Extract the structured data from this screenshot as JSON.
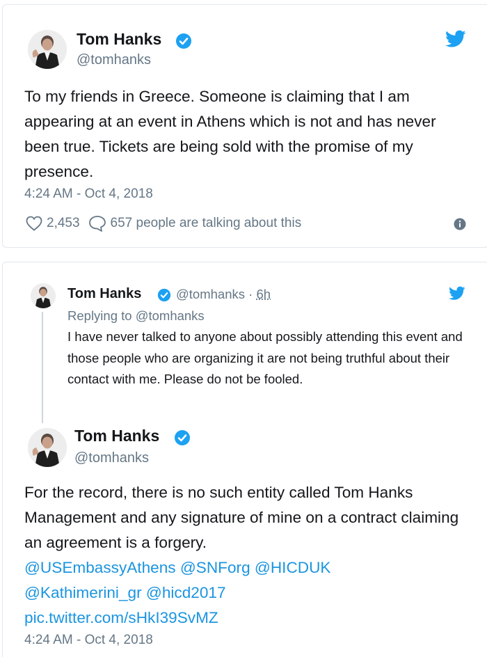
{
  "tweet1": {
    "name": "Tom Hanks",
    "handle": "@tomhanks",
    "text": "To my friends in Greece. Someone is claiming that I am appearing at an event in Athens which is not and has never been true. Tickets are being sold with the promise of my presence.",
    "timestamp": "4:24 AM - Oct 4, 2018",
    "likes": "2,453",
    "talking": "657 people are talking about this"
  },
  "reply_tweet": {
    "name": "Tom Hanks",
    "handle": "@tomhanks",
    "time_sep": "·",
    "age": "6h",
    "replying_to": "Replying to @tomhanks",
    "text": "I have never talked to anyone about possibly attending this event and those people who are organizing it are not being truthful about their contact with me. Please do not be fooled."
  },
  "tweet2": {
    "name": "Tom Hanks",
    "handle": "@tomhanks",
    "text": "For the record, there is no such entity called Tom Hanks Management and any signature of mine on a contract claiming an agreement is a forgery.",
    "links": [
      "@USEmbassyAthens",
      "@SNForg",
      "@HICDUK",
      "@Kathimerini_gr",
      "@hicd2017",
      "pic.twitter.com/sHkI39SvMZ"
    ],
    "timestamp": "4:24 AM - Oct 4, 2018"
  },
  "colors": {
    "twitter_blue": "#1da1f2",
    "link_blue": "#1b95e0",
    "text": "#14171a",
    "muted": "#657786",
    "border": "#e1e8ed"
  },
  "icons": [
    "verified-badge-icon",
    "twitter-bird-icon",
    "heart-icon",
    "reply-bubble-icon",
    "info-icon"
  ]
}
